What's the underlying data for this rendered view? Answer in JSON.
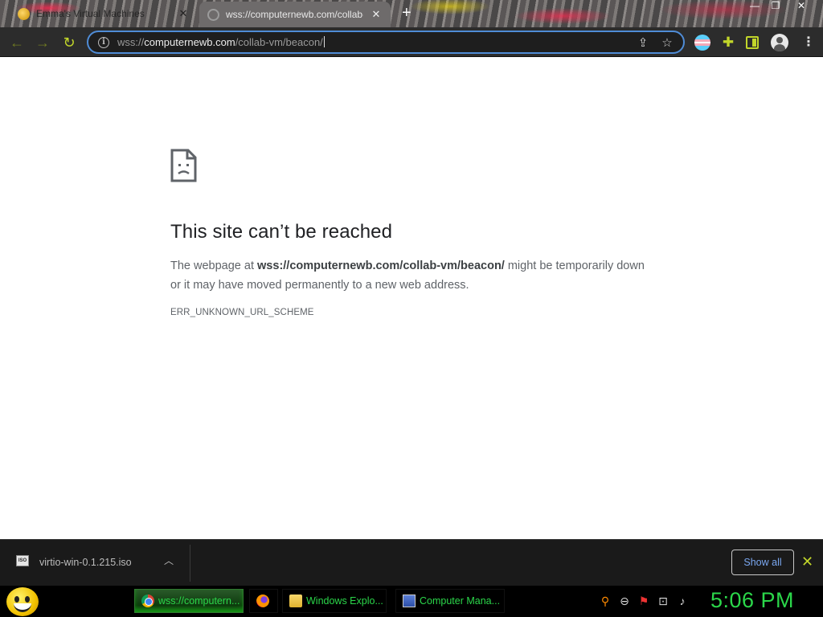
{
  "browser": {
    "tabs": [
      {
        "title": "Emma's Virtual Machines",
        "active": false
      },
      {
        "title": "wss://computernewb.com/collab-vm/beacon/",
        "active": true
      }
    ],
    "new_tab_icon": "plus-icon",
    "window_controls": [
      "minimize-icon",
      "restore-icon",
      "close-icon"
    ]
  },
  "toolbar": {
    "url_scheme": "wss://",
    "url_host": "computernewb.com",
    "url_path": "/collab-vm/beacon/",
    "accent_color": "#c2d62a",
    "focus_color": "#4f8cd6"
  },
  "page": {
    "title": "This site can’t be reached",
    "desc_prefix": "The webpage at ",
    "desc_url": "wss://computernewb.com/collab-vm/beacon/",
    "desc_suffix": " might be temporarily down or it may have moved permanently to a new web address.",
    "error_code": "ERR_UNKNOWN_URL_SCHEME"
  },
  "downloads": {
    "file_name": "virtio-win-0.1.215.iso",
    "file_icon_label": "ISO",
    "show_all_label": "Show all"
  },
  "taskbar": {
    "items": [
      {
        "label": "wss://computern...",
        "icon": "chrome-icon"
      },
      {
        "label": "",
        "icon": "firefox-icon"
      },
      {
        "label": "Windows Explo...",
        "icon": "folder-icon"
      },
      {
        "label": "Computer Mana...",
        "icon": "computer-management-icon"
      }
    ],
    "clock": "5:06 PM",
    "text_color": "#2bd74a"
  }
}
